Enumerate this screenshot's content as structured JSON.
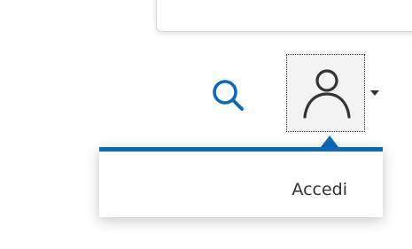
{
  "header": {
    "search_icon": "search-icon",
    "user_icon": "user-icon",
    "caret_icon": "caret-down-icon"
  },
  "dropdown": {
    "items": [
      {
        "label": "Accedi"
      }
    ]
  },
  "colors": {
    "accent": "#0a6ab5",
    "text": "#333333",
    "user_button_bg": "#f3f3f3"
  }
}
